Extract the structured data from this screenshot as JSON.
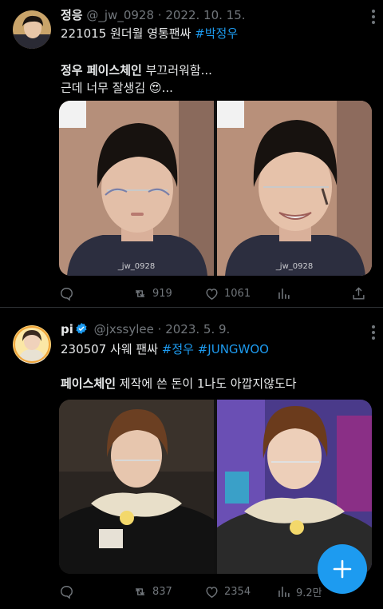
{
  "tweets": [
    {
      "display_name": "정응",
      "handle": "@_jw_0928",
      "dot": "·",
      "date": "2022. 10. 15.",
      "verified": false,
      "line1_plain": "221015 원더월 영통팬싸 ",
      "line1_tag": "#박정우",
      "line2_bold": "정우 페이스체인",
      "line2_rest": " 부끄러워함...",
      "line3_text": "근데 너무 잘생김",
      "line3_emoji": "😍",
      "line3_tail": "...",
      "watermark_left": "_jw_0928",
      "watermark_right": "_jw_0928",
      "reply_count": "",
      "retweet_count": "919",
      "like_count": "1061",
      "views_count": ""
    },
    {
      "display_name": "pi",
      "handle": "@jxssylee",
      "dot": "·",
      "date": "2023. 5. 9.",
      "verified": true,
      "line1_plain": "230507 사웨 팬싸 ",
      "line1_tag1": "#정우",
      "line1_tag2": "#JUNGWOO",
      "line2_bold": "페이스체인",
      "line2_rest": " 제작에 쓴 돈이 1나도 아깝지않도다",
      "reply_count": "",
      "retweet_count": "837",
      "like_count": "2354",
      "views_count": "9.2만"
    }
  ],
  "fab": {
    "icon": "plus-icon"
  },
  "colors": {
    "accent": "#1d9bf0",
    "muted": "#71767b",
    "text": "#e7e9ea",
    "background": "#000000"
  }
}
